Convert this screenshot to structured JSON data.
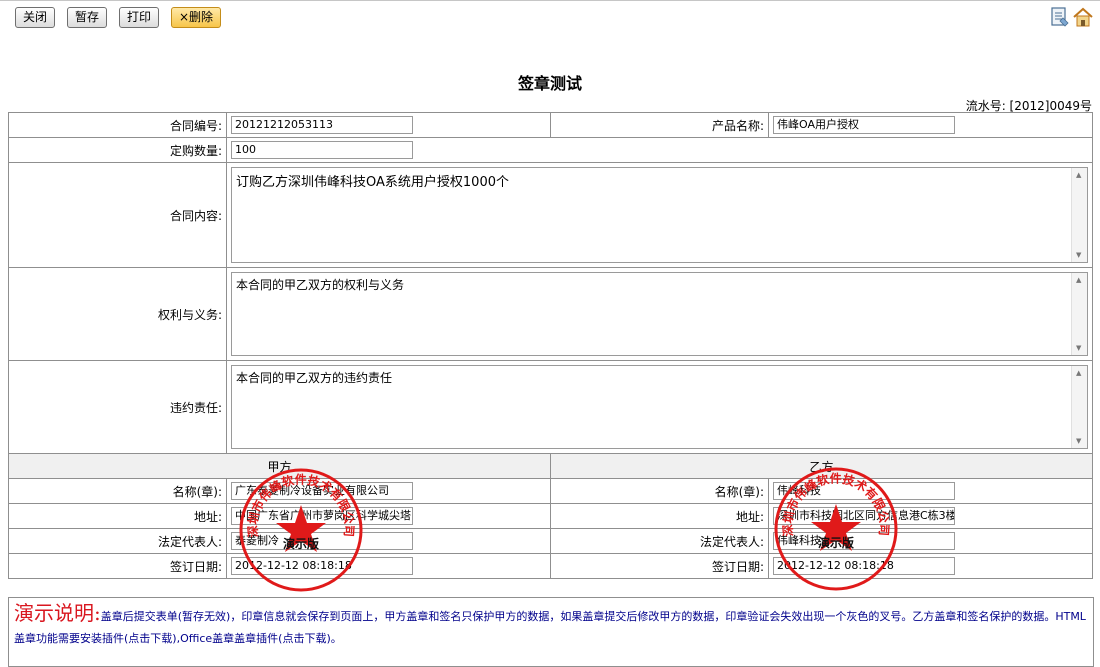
{
  "toolbar": {
    "close_label": "关闭",
    "save_label": "暂存",
    "print_label": "打印",
    "delete_label": "×删除"
  },
  "title": "签章测试",
  "serial": "流水号: [2012]0049号",
  "fields": {
    "contract_no_label": "合同编号:",
    "contract_no_value": "20121212053113",
    "product_name_label": "产品名称:",
    "product_name_value": "伟峰OA用户授权",
    "quantity_label": "定购数量:",
    "quantity_value": "100",
    "content_label": "合同内容:",
    "content_value": "订购乙方深圳伟峰科技OA系统用户授权1000个",
    "rights_label": "权利与义务:",
    "rights_value": "本合同的甲乙双方的权利与义务",
    "breach_label": "违约责任:",
    "breach_value": "本合同的甲乙双方的违约责任"
  },
  "party_a": {
    "header": "甲方",
    "name_label": "名称(章):",
    "name_value": "广东泰菱制冷设备实业有限公司",
    "address_label": "地址:",
    "address_value": "中国广东省广州市萝岗区科学城尖塔L",
    "rep_label": "法定代表人:",
    "rep_value": "泰菱制冷",
    "date_label": "签订日期:",
    "date_value": "2012-12-12 08:18:18"
  },
  "party_b": {
    "header": "乙方",
    "name_label": "名称(章):",
    "name_value": "伟峰科技",
    "address_label": "地址:",
    "address_value": "深圳市科技园北区同方信息港C栋3楼",
    "rep_label": "法定代表人:",
    "rep_value": "伟峰科技",
    "date_label": "签订日期:",
    "date_value": "2012-12-12 08:18:18"
  },
  "seal": {
    "ring_text": "深圳市伟峰软件技术有限公司",
    "center_text": "演示版",
    "color": "#e01a1a"
  },
  "note": {
    "heading": "演示说明:",
    "body": "盖章后提交表单(暂存无效)，印章信息就会保存到页面上，甲方盖章和签名只保护甲方的数据，如果盖章提交后修改甲方的数据，印章验证会失效出现一个灰色的叉号。乙方盖章和签名保护的数据。HTML盖章功能需要安装插件(点击下载),Office盖章盖章插件(点击下载)。"
  },
  "icons": [
    "document-icon",
    "home-icon"
  ]
}
